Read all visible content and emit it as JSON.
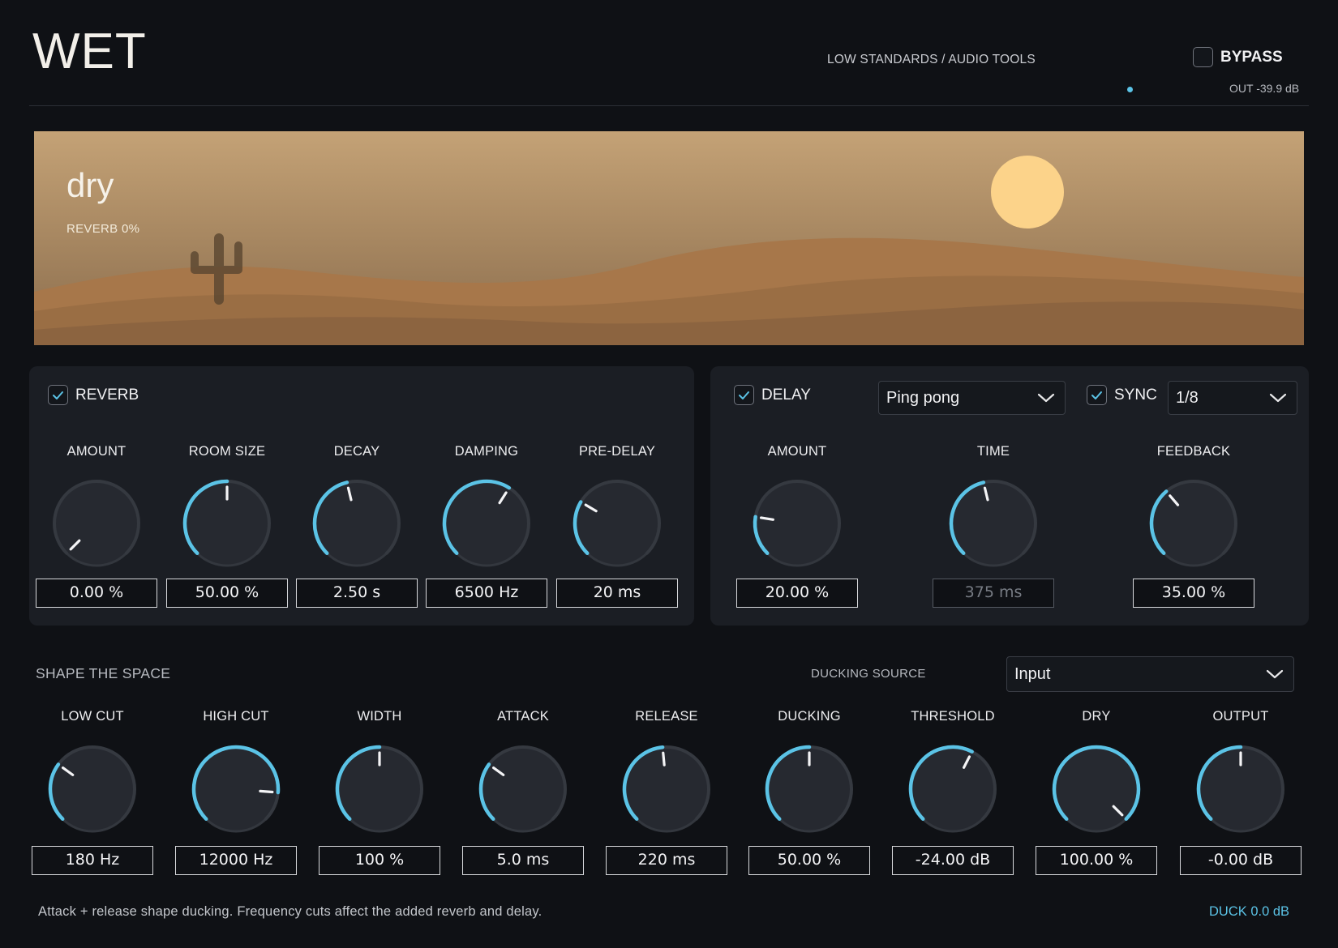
{
  "header": {
    "title": "WET",
    "brand": "LOW STANDARDS / AUDIO TOOLS",
    "bypass_label": "BYPASS",
    "bypass_checked": false,
    "out_readout": "OUT  -39.9 dB"
  },
  "scene": {
    "mode_name": "dry",
    "mode_sub": "REVERB  0%",
    "colors": {
      "sky_top": "#c4a276",
      "sky_bottom": "#8a6c4c",
      "sun": "#fcd38a",
      "dune": "#a7774a"
    }
  },
  "reverb": {
    "label": "REVERB",
    "enabled": true,
    "knobs": [
      {
        "id": "amount",
        "label": "AMOUNT",
        "value": "0.00 %",
        "level": 0.0
      },
      {
        "id": "room-size",
        "label": "ROOM SIZE",
        "value": "50.00 %",
        "level": 0.5
      },
      {
        "id": "decay",
        "label": "DECAY",
        "value": "2.50 s",
        "level": 0.45
      },
      {
        "id": "damping",
        "label": "DAMPING",
        "value": "6500 Hz",
        "level": 0.62
      },
      {
        "id": "pre-delay",
        "label": "PRE-DELAY",
        "value": "20 ms",
        "level": 0.28
      }
    ]
  },
  "delay": {
    "label": "DELAY",
    "enabled": true,
    "mode": "Ping pong",
    "sync_label": "SYNC",
    "sync_enabled": true,
    "division": "1/8",
    "knobs": [
      {
        "id": "amount",
        "label": "AMOUNT",
        "value": "20.00 %",
        "level": 0.2,
        "disabled": false
      },
      {
        "id": "time",
        "label": "TIME",
        "value": "375 ms",
        "level": 0.45,
        "disabled": true
      },
      {
        "id": "feedback",
        "label": "FEEDBACK",
        "value": "35.00 %",
        "level": 0.35,
        "disabled": false
      }
    ]
  },
  "shape": {
    "title": "SHAPE THE SPACE",
    "ducking_source_label": "DUCKING SOURCE",
    "ducking_source": "Input",
    "knobs": [
      {
        "id": "low-cut",
        "label": "LOW CUT",
        "value": "180 Hz",
        "level": 0.3
      },
      {
        "id": "high-cut",
        "label": "HIGH CUT",
        "value": "12000 Hz",
        "level": 0.85
      },
      {
        "id": "width",
        "label": "WIDTH",
        "value": "100 %",
        "level": 0.5
      },
      {
        "id": "attack",
        "label": "ATTACK",
        "value": "5.0 ms",
        "level": 0.3
      },
      {
        "id": "release",
        "label": "RELEASE",
        "value": "220 ms",
        "level": 0.48
      },
      {
        "id": "ducking",
        "label": "DUCKING",
        "value": "50.00 %",
        "level": 0.5
      },
      {
        "id": "threshold",
        "label": "THRESHOLD",
        "value": "-24.00 dB",
        "level": 0.6
      },
      {
        "id": "dry",
        "label": "DRY",
        "value": "100.00 %",
        "level": 1.0
      },
      {
        "id": "output",
        "label": "OUTPUT",
        "value": "-0.00 dB",
        "level": 0.5
      }
    ]
  },
  "footer": {
    "note": "Attack + release shape ducking. Frequency cuts affect the added reverb and delay.",
    "duck_readout": "DUCK  0.0 dB"
  },
  "colors": {
    "accent": "#5bc3e6",
    "background": "#0f1115",
    "panel": "#1b1e24"
  }
}
